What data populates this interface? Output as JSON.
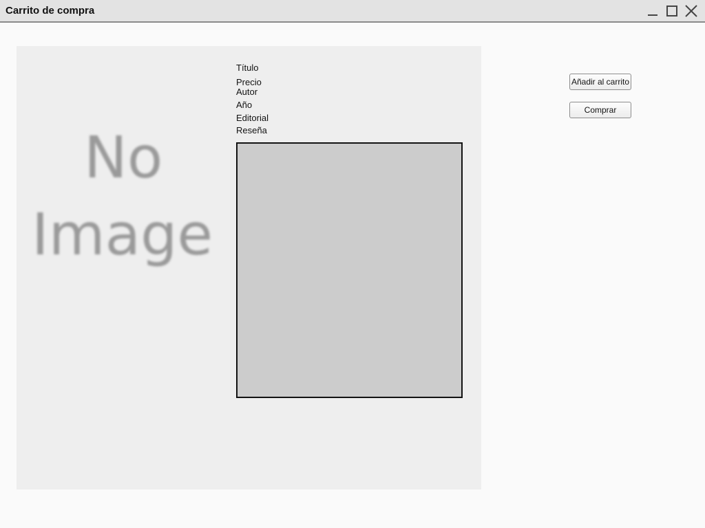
{
  "window": {
    "title": "Carrito de compra",
    "controls": [
      "minimize-icon",
      "maximize-icon",
      "close-icon"
    ]
  },
  "product": {
    "image_placeholder_line1": "No",
    "image_placeholder_line2": "Image",
    "labels": {
      "titulo": "Título",
      "precio": "Precio",
      "autor": "Autor",
      "anio": "Año",
      "editorial": "Editorial",
      "resena": "Reseña"
    },
    "review_value": ""
  },
  "actions": {
    "add_to_cart": "Añadir al carrito",
    "buy": "Comprar"
  },
  "colors": {
    "titlebar": "#e3e3e3",
    "panel": "#eeeeee",
    "review_box": "#cccccc"
  }
}
